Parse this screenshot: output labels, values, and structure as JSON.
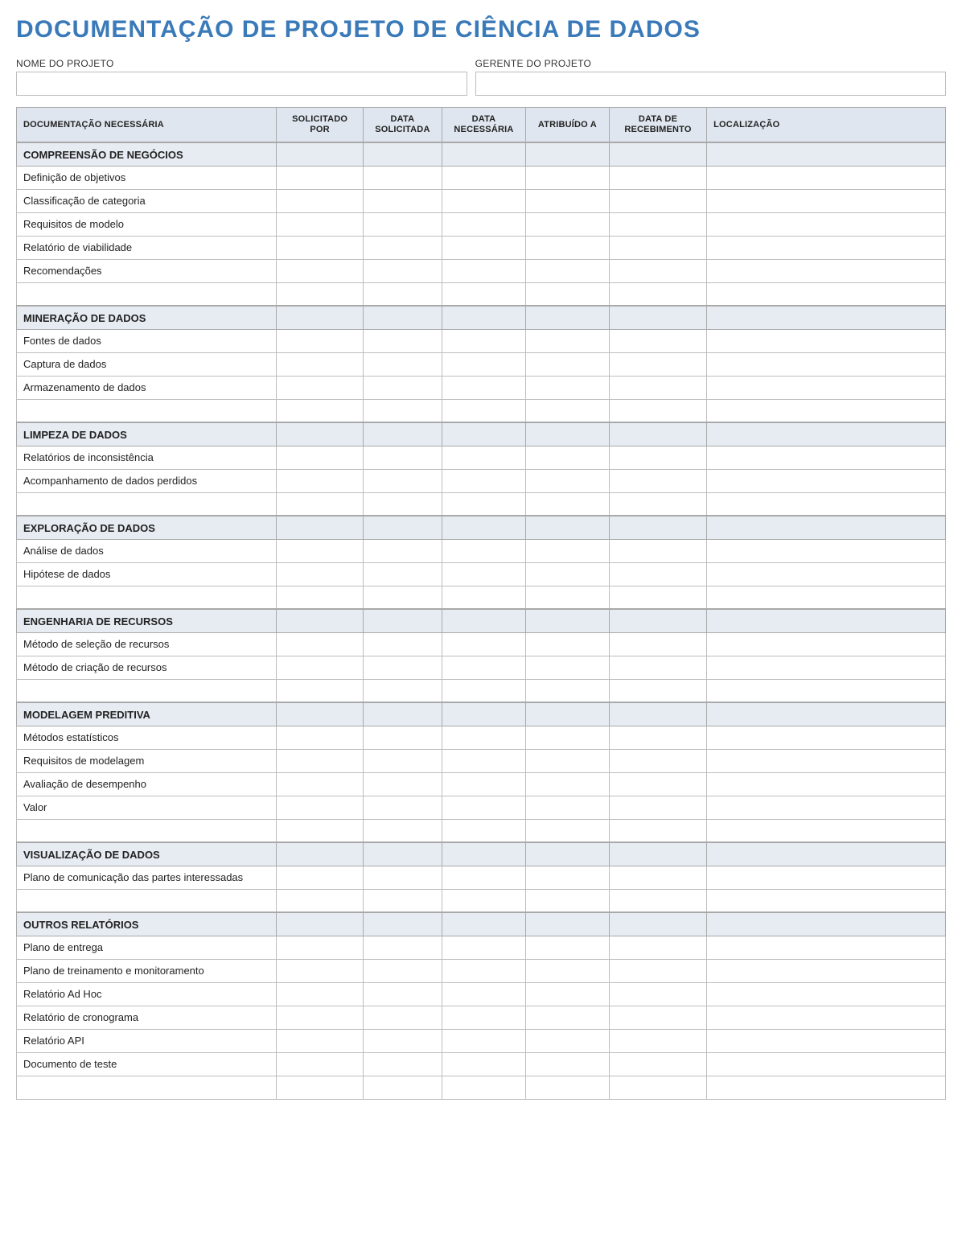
{
  "title": "DOCUMENTAÇÃO DE PROJETO DE CIÊNCIA DE DADOS",
  "meta": {
    "projectNameLabel": "NOME DO PROJETO",
    "projectNameValue": "",
    "projectManagerLabel": "GERENTE DO PROJETO",
    "projectManagerValue": ""
  },
  "columns": [
    "DOCUMENTAÇÃO NECESSÁRIA",
    "SOLICITADO POR",
    "DATA SOLICITADA",
    "DATA NECESSÁRIA",
    "ATRIBUÍDO A",
    "DATA DE RECEBIMENTO",
    "LOCALIZAÇÃO"
  ],
  "sections": [
    {
      "name": "COMPREENSÃO DE NEGÓCIOS",
      "rows": [
        {
          "doc": "Definição de objetivos",
          "requestedBy": "",
          "dateRequested": "",
          "dateNeeded": "",
          "assignedTo": "",
          "dateReceived": "",
          "location": ""
        },
        {
          "doc": "Classificação de categoria",
          "requestedBy": "",
          "dateRequested": "",
          "dateNeeded": "",
          "assignedTo": "",
          "dateReceived": "",
          "location": ""
        },
        {
          "doc": "Requisitos de modelo",
          "requestedBy": "",
          "dateRequested": "",
          "dateNeeded": "",
          "assignedTo": "",
          "dateReceived": "",
          "location": ""
        },
        {
          "doc": "Relatório de viabilidade",
          "requestedBy": "",
          "dateRequested": "",
          "dateNeeded": "",
          "assignedTo": "",
          "dateReceived": "",
          "location": ""
        },
        {
          "doc": "Recomendações",
          "requestedBy": "",
          "dateRequested": "",
          "dateNeeded": "",
          "assignedTo": "",
          "dateReceived": "",
          "location": ""
        },
        {
          "doc": "",
          "requestedBy": "",
          "dateRequested": "",
          "dateNeeded": "",
          "assignedTo": "",
          "dateReceived": "",
          "location": ""
        }
      ]
    },
    {
      "name": "MINERAÇÃO DE DADOS",
      "rows": [
        {
          "doc": "Fontes de dados",
          "requestedBy": "",
          "dateRequested": "",
          "dateNeeded": "",
          "assignedTo": "",
          "dateReceived": "",
          "location": ""
        },
        {
          "doc": "Captura de dados",
          "requestedBy": "",
          "dateRequested": "",
          "dateNeeded": "",
          "assignedTo": "",
          "dateReceived": "",
          "location": ""
        },
        {
          "doc": "Armazenamento de dados",
          "requestedBy": "",
          "dateRequested": "",
          "dateNeeded": "",
          "assignedTo": "",
          "dateReceived": "",
          "location": ""
        },
        {
          "doc": "",
          "requestedBy": "",
          "dateRequested": "",
          "dateNeeded": "",
          "assignedTo": "",
          "dateReceived": "",
          "location": ""
        }
      ]
    },
    {
      "name": "LIMPEZA DE DADOS",
      "rows": [
        {
          "doc": "Relatórios de inconsistência",
          "requestedBy": "",
          "dateRequested": "",
          "dateNeeded": "",
          "assignedTo": "",
          "dateReceived": "",
          "location": ""
        },
        {
          "doc": "Acompanhamento de dados perdidos",
          "requestedBy": "",
          "dateRequested": "",
          "dateNeeded": "",
          "assignedTo": "",
          "dateReceived": "",
          "location": ""
        },
        {
          "doc": "",
          "requestedBy": "",
          "dateRequested": "",
          "dateNeeded": "",
          "assignedTo": "",
          "dateReceived": "",
          "location": ""
        }
      ]
    },
    {
      "name": "EXPLORAÇÃO DE DADOS",
      "rows": [
        {
          "doc": "Análise de dados",
          "requestedBy": "",
          "dateRequested": "",
          "dateNeeded": "",
          "assignedTo": "",
          "dateReceived": "",
          "location": ""
        },
        {
          "doc": "Hipótese de dados",
          "requestedBy": "",
          "dateRequested": "",
          "dateNeeded": "",
          "assignedTo": "",
          "dateReceived": "",
          "location": ""
        },
        {
          "doc": "",
          "requestedBy": "",
          "dateRequested": "",
          "dateNeeded": "",
          "assignedTo": "",
          "dateReceived": "",
          "location": ""
        }
      ]
    },
    {
      "name": "ENGENHARIA DE RECURSOS",
      "rows": [
        {
          "doc": "Método de seleção de recursos",
          "requestedBy": "",
          "dateRequested": "",
          "dateNeeded": "",
          "assignedTo": "",
          "dateReceived": "",
          "location": ""
        },
        {
          "doc": "Método de criação de recursos",
          "requestedBy": "",
          "dateRequested": "",
          "dateNeeded": "",
          "assignedTo": "",
          "dateReceived": "",
          "location": ""
        },
        {
          "doc": "",
          "requestedBy": "",
          "dateRequested": "",
          "dateNeeded": "",
          "assignedTo": "",
          "dateReceived": "",
          "location": ""
        }
      ]
    },
    {
      "name": "MODELAGEM PREDITIVA",
      "rows": [
        {
          "doc": "Métodos estatísticos",
          "requestedBy": "",
          "dateRequested": "",
          "dateNeeded": "",
          "assignedTo": "",
          "dateReceived": "",
          "location": ""
        },
        {
          "doc": "Requisitos de modelagem",
          "requestedBy": "",
          "dateRequested": "",
          "dateNeeded": "",
          "assignedTo": "",
          "dateReceived": "",
          "location": ""
        },
        {
          "doc": "Avaliação de desempenho",
          "requestedBy": "",
          "dateRequested": "",
          "dateNeeded": "",
          "assignedTo": "",
          "dateReceived": "",
          "location": ""
        },
        {
          "doc": "Valor",
          "requestedBy": "",
          "dateRequested": "",
          "dateNeeded": "",
          "assignedTo": "",
          "dateReceived": "",
          "location": ""
        },
        {
          "doc": "",
          "requestedBy": "",
          "dateRequested": "",
          "dateNeeded": "",
          "assignedTo": "",
          "dateReceived": "",
          "location": ""
        }
      ]
    },
    {
      "name": "VISUALIZAÇÃO DE DADOS",
      "rows": [
        {
          "doc": "Plano de comunicação das partes interessadas",
          "requestedBy": "",
          "dateRequested": "",
          "dateNeeded": "",
          "assignedTo": "",
          "dateReceived": "",
          "location": ""
        },
        {
          "doc": "",
          "requestedBy": "",
          "dateRequested": "",
          "dateNeeded": "",
          "assignedTo": "",
          "dateReceived": "",
          "location": ""
        }
      ]
    },
    {
      "name": "OUTROS RELATÓRIOS",
      "rows": [
        {
          "doc": "Plano de entrega",
          "requestedBy": "",
          "dateRequested": "",
          "dateNeeded": "",
          "assignedTo": "",
          "dateReceived": "",
          "location": ""
        },
        {
          "doc": "Plano de treinamento e monitoramento",
          "requestedBy": "",
          "dateRequested": "",
          "dateNeeded": "",
          "assignedTo": "",
          "dateReceived": "",
          "location": ""
        },
        {
          "doc": "Relatório Ad Hoc",
          "requestedBy": "",
          "dateRequested": "",
          "dateNeeded": "",
          "assignedTo": "",
          "dateReceived": "",
          "location": ""
        },
        {
          "doc": "Relatório de cronograma",
          "requestedBy": "",
          "dateRequested": "",
          "dateNeeded": "",
          "assignedTo": "",
          "dateReceived": "",
          "location": ""
        },
        {
          "doc": "Relatório API",
          "requestedBy": "",
          "dateRequested": "",
          "dateNeeded": "",
          "assignedTo": "",
          "dateReceived": "",
          "location": ""
        },
        {
          "doc": "Documento de teste",
          "requestedBy": "",
          "dateRequested": "",
          "dateNeeded": "",
          "assignedTo": "",
          "dateReceived": "",
          "location": ""
        },
        {
          "doc": "",
          "requestedBy": "",
          "dateRequested": "",
          "dateNeeded": "",
          "assignedTo": "",
          "dateReceived": "",
          "location": ""
        }
      ]
    }
  ]
}
